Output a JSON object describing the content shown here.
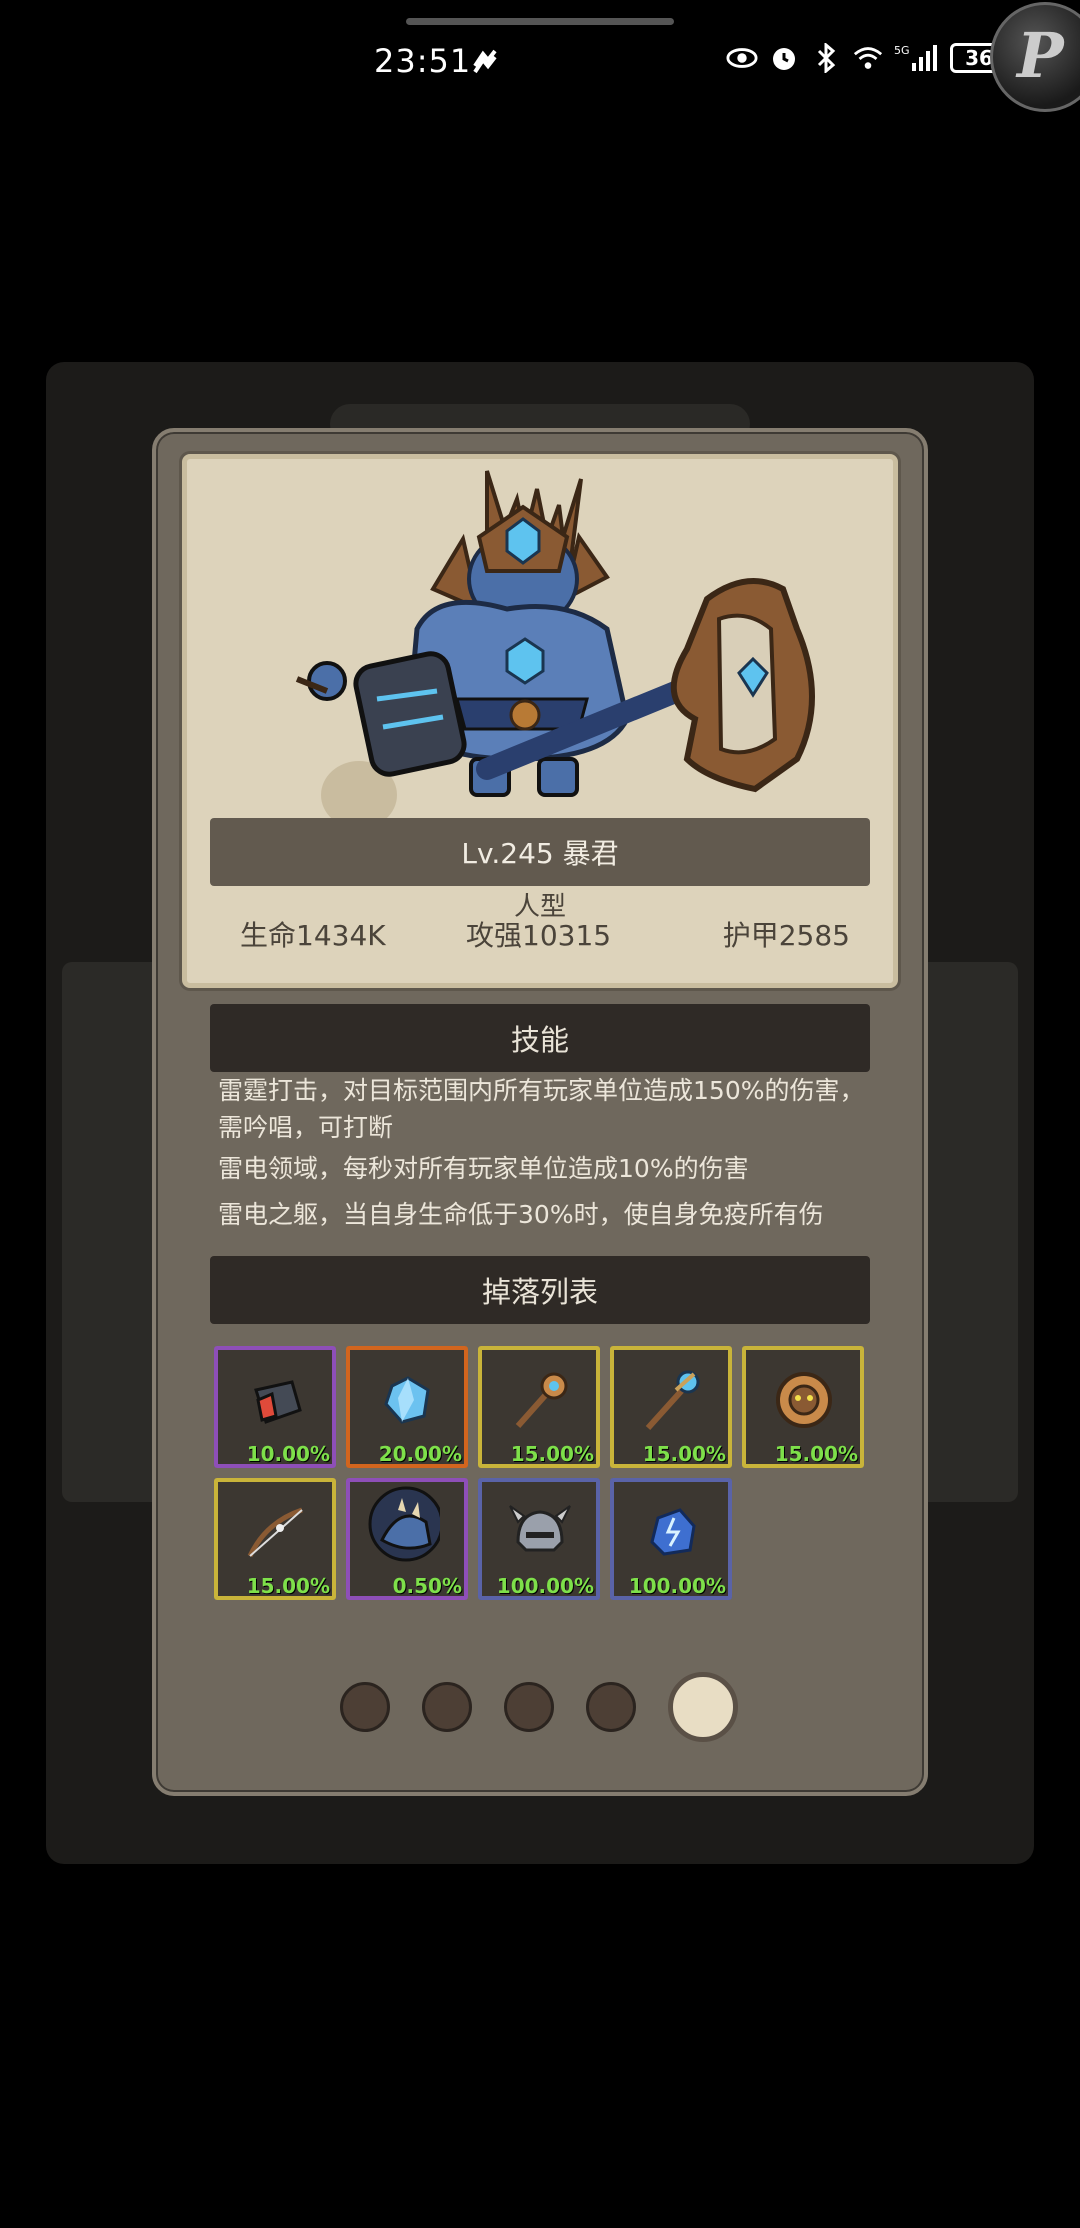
{
  "statusbar": {
    "time": "23:51",
    "battery": "36",
    "network": "5G",
    "icons": [
      "eye-icon",
      "alarm-icon",
      "bluetooth-icon",
      "wifi-icon",
      "signal-icon"
    ]
  },
  "monster": {
    "title": "Lv.245 暴君",
    "type": "人型",
    "life": "生命1434K",
    "attack": "攻强10315",
    "armor": "护甲2585"
  },
  "skills": {
    "header": "技能",
    "items": [
      "雷霆打击，对目标范围内所有玩家单位造成150%的伤害，需吟唱，可打断",
      "雷电领域，每秒对所有玩家单位造成10%的伤害",
      "雷电之躯，当自身生命低于30%时，使自身免疫所有伤"
    ]
  },
  "drops": {
    "header": "掉落列表",
    "items": [
      {
        "icon": "gauntlet-icon",
        "rate": "10.00%",
        "rarity_color": "#8e4fb8"
      },
      {
        "icon": "crystal-icon",
        "rate": "20.00%",
        "rarity_color": "#d2651e"
      },
      {
        "icon": "mace-icon",
        "rate": "15.00%",
        "rarity_color": "#c9b43a"
      },
      {
        "icon": "staff-icon",
        "rate": "15.00%",
        "rarity_color": "#c9b43a"
      },
      {
        "icon": "shield-icon",
        "rate": "15.00%",
        "rarity_color": "#c9b43a"
      },
      {
        "icon": "bow-icon",
        "rate": "15.00%",
        "rarity_color": "#c9b43a"
      },
      {
        "icon": "mount-icon",
        "rate": "0.50%",
        "rarity_color": "#8e4fb8"
      },
      {
        "icon": "helmet-icon",
        "rate": "100.00%",
        "rarity_color": "#5a63a8"
      },
      {
        "icon": "ore-icon",
        "rate": "100.00%",
        "rarity_color": "#5a63a8"
      }
    ]
  },
  "pager": {
    "total": 5,
    "current": 5
  }
}
